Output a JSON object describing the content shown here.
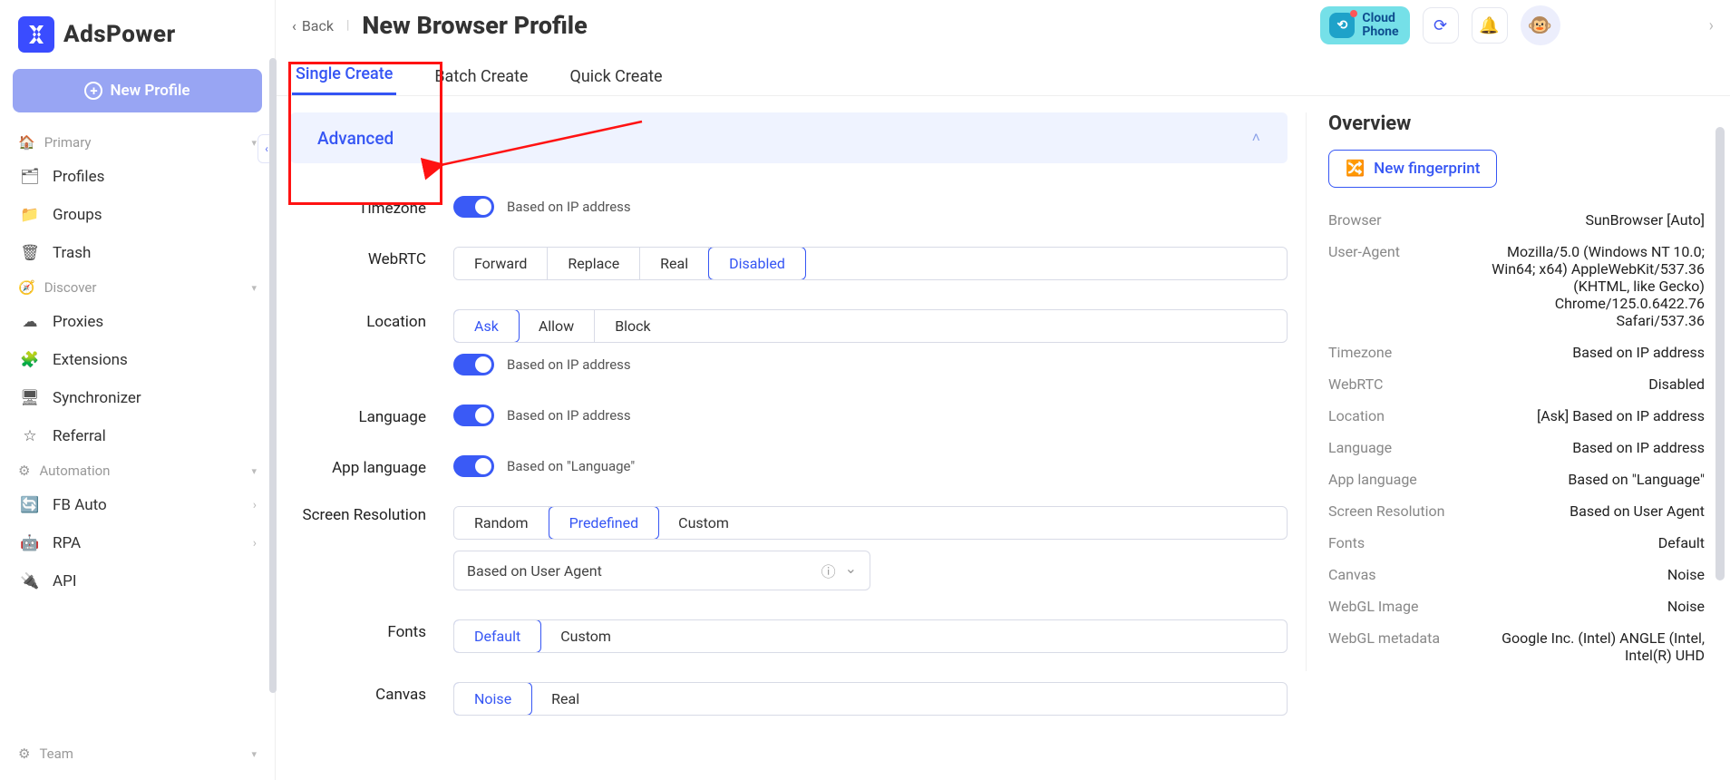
{
  "brand": "AdsPower",
  "sidebar": {
    "new_profile": "New Profile",
    "sections": {
      "primary": "Primary",
      "discover": "Discover",
      "automation": "Automation",
      "team": "Team"
    },
    "items": {
      "profiles": "Profiles",
      "groups": "Groups",
      "trash": "Trash",
      "proxies": "Proxies",
      "extensions": "Extensions",
      "synchronizer": "Synchronizer",
      "referral": "Referral",
      "fb_auto": "FB Auto",
      "rpa": "RPA",
      "api": "API"
    }
  },
  "topbar": {
    "back": "Back",
    "title": "New Browser Profile",
    "cloud_phone_l1": "Cloud",
    "cloud_phone_l2": "Phone"
  },
  "tabs": {
    "single": "Single Create",
    "batch": "Batch Create",
    "quick": "Quick Create"
  },
  "section": {
    "advanced": "Advanced"
  },
  "labels": {
    "timezone": "Timezone",
    "webrtc": "WebRTC",
    "location": "Location",
    "language": "Language",
    "app_language": "App language",
    "screen_res": "Screen Resolution",
    "fonts": "Fonts",
    "canvas": "Canvas"
  },
  "helpers": {
    "based_ip": "Based on IP address",
    "based_lang": "Based on \"Language\""
  },
  "opts": {
    "webrtc": {
      "forward": "Forward",
      "replace": "Replace",
      "real": "Real",
      "disabled": "Disabled"
    },
    "location": {
      "ask": "Ask",
      "allow": "Allow",
      "block": "Block"
    },
    "screen": {
      "random": "Random",
      "predefined": "Predefined",
      "custom": "Custom"
    },
    "fonts": {
      "default": "Default",
      "custom": "Custom"
    },
    "canvas": {
      "noise": "Noise",
      "real": "Real"
    },
    "ua_select": "Based on User Agent"
  },
  "overview": {
    "title": "Overview",
    "new_fp": "New fingerprint",
    "rows": {
      "browser_k": "Browser",
      "browser_v": "SunBrowser [Auto]",
      "ua_k": "User-Agent",
      "ua_v": "Mozilla/5.0 (Windows NT 10.0; Win64; x64) AppleWebKit/537.36 (KHTML, like Gecko) Chrome/125.0.6422.76 Safari/537.36",
      "tz_k": "Timezone",
      "tz_v": "Based on IP address",
      "webrtc_k": "WebRTC",
      "webrtc_v": "Disabled",
      "loc_k": "Location",
      "loc_v": "[Ask] Based on IP address",
      "lang_k": "Language",
      "lang_v": "Based on IP address",
      "applang_k": "App language",
      "applang_v": "Based on \"Language\"",
      "sr_k": "Screen Resolution",
      "sr_v": "Based on User Agent",
      "fonts_k": "Fonts",
      "fonts_v": "Default",
      "canvas_k": "Canvas",
      "canvas_v": "Noise",
      "webgli_k": "WebGL Image",
      "webgli_v": "Noise",
      "webglm_k": "WebGL metadata",
      "webglm_v": "Google Inc. (Intel) ANGLE (Intel, Intel(R) UHD"
    }
  }
}
